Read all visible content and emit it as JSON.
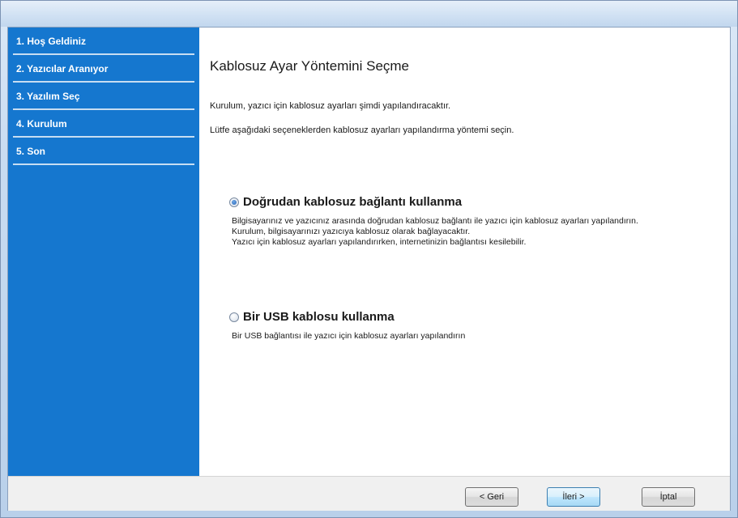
{
  "sidebar": {
    "items": [
      {
        "label": "1. Hoş Geldiniz"
      },
      {
        "label": "2. Yazıcılar Aranıyor"
      },
      {
        "label": "3. Yazılım Seç"
      },
      {
        "label": "4. Kurulum"
      },
      {
        "label": "5. Son"
      }
    ]
  },
  "main": {
    "title": "Kablosuz Ayar Yöntemini Seçme",
    "intro1": "Kurulum, yazıcı için kablosuz ayarları şimdi yapılandıracaktır.",
    "intro2": "Lütfe aşağıdaki seçeneklerden kablosuz ayarları yapılandırma yöntemi seçin.",
    "options": [
      {
        "label": "Doğrudan kablosuz bağlantı kullanma",
        "selected": true,
        "desc": [
          "Bilgisayarınız ve yazıcınız arasında doğrudan kablosuz bağlantı ile yazıcı için kablosuz ayarları yapılandırın.",
          "Kurulum, bilgisayarınızı yazıcıya kablosuz olarak bağlayacaktır.",
          "Yazıcı için kablosuz ayarları yapılandırırken, internetinizin bağlantısı kesilebilir."
        ]
      },
      {
        "label": "Bir USB kablosu kullanma",
        "selected": false,
        "desc": [
          "Bir USB bağlantısı ile yazıcı için kablosuz ayarları yapılandırın"
        ]
      }
    ]
  },
  "footer": {
    "back_label": "< Geri",
    "next_label": "İleri >",
    "cancel_label": "İptal"
  }
}
